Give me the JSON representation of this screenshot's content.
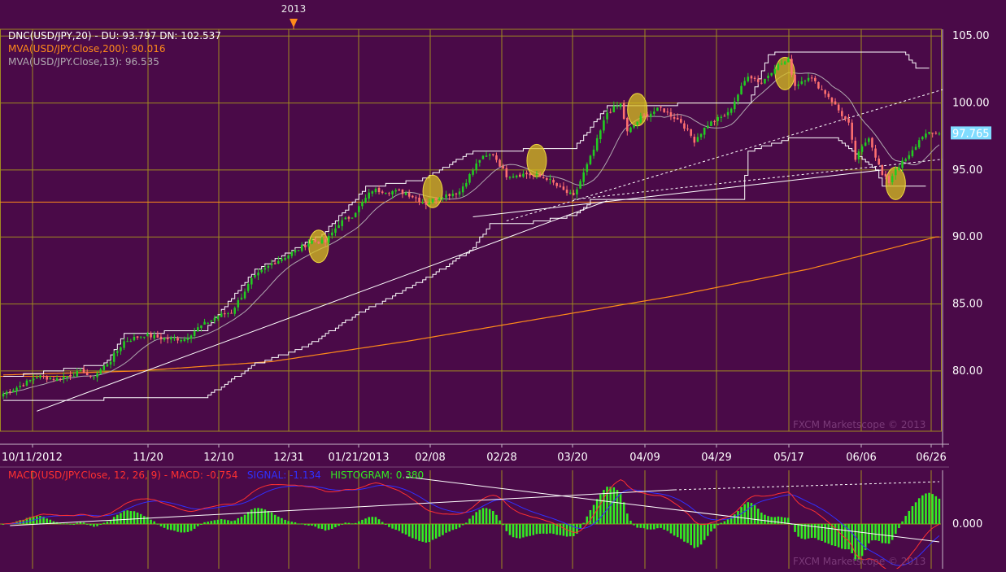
{
  "colors": {
    "background": "#4a0a48",
    "grid": "#a08a20",
    "up_candle": "#22cc22",
    "down_candle": "#ff7070",
    "mva200": "#ff8a1a",
    "mva13": "#b0a8b0",
    "dnc": "#ffffff",
    "macd": "#ff3030",
    "signal": "#3030ff",
    "histogram": "#33ee22",
    "price_tag": "#80dcff",
    "highlight": "#d8c020"
  },
  "year_marker": "2013",
  "legend": {
    "dnc": "DNC(USD/JPY,20)  -   DU: 93.797   DN: 102.537",
    "mva200": "MVA(USD/JPY.Close,200): 90.016",
    "mva13": "MVA(USD/JPY.Close,13): 96.535"
  },
  "macd_legend": {
    "macd": "MACD(USD/JPY.Close, 12, 26, 9)  -   MACD: -0.754",
    "signal": "SIGNAL: -1.134",
    "histogram": "HISTOGRAM: 0.380"
  },
  "price_tag": "97.765",
  "watermark": "FXCM Marketscope © 2013",
  "chart_data": [
    {
      "type": "candlestick",
      "instrument": "USD/JPY",
      "x_labels": [
        "10/11/2012",
        "11/20",
        "12/10",
        "12/31",
        "01/21/2013",
        "02/08",
        "02/28",
        "03/20",
        "04/09",
        "04/29",
        "05/17",
        "06/06",
        "06/26"
      ],
      "y_ticks": [
        "105.00",
        "100.00",
        "95.00",
        "90.00",
        "85.00",
        "80.00"
      ],
      "ylim": [
        75.5,
        105.5
      ],
      "last_price": 97.765,
      "close_anchors": [
        [
          0,
          78.3
        ],
        [
          6,
          79.0
        ],
        [
          10,
          79.6
        ],
        [
          16,
          79.4
        ],
        [
          24,
          80.0
        ],
        [
          26,
          79.4
        ],
        [
          32,
          80.8
        ],
        [
          36,
          82.2
        ],
        [
          42,
          82.7
        ],
        [
          48,
          82.4
        ],
        [
          54,
          82.4
        ],
        [
          58,
          83.2
        ],
        [
          64,
          84.1
        ],
        [
          68,
          84.4
        ],
        [
          74,
          86.8
        ],
        [
          80,
          88.0
        ],
        [
          86,
          88.8
        ],
        [
          92,
          89.7
        ],
        [
          96,
          89.6
        ],
        [
          100,
          91.0
        ],
        [
          104,
          91.6
        ],
        [
          110,
          93.5
        ],
        [
          116,
          93.4
        ],
        [
          120,
          93.3
        ],
        [
          126,
          92.5
        ],
        [
          130,
          93.0
        ],
        [
          136,
          93.4
        ],
        [
          142,
          95.8
        ],
        [
          146,
          96.2
        ],
        [
          150,
          94.6
        ],
        [
          156,
          94.7
        ],
        [
          162,
          94.4
        ],
        [
          166,
          93.6
        ],
        [
          170,
          93.0
        ],
        [
          176,
          96.5
        ],
        [
          180,
          99.3
        ],
        [
          184,
          99.9
        ],
        [
          186,
          97.8
        ],
        [
          190,
          98.9
        ],
        [
          196,
          99.6
        ],
        [
          202,
          98.6
        ],
        [
          206,
          97.2
        ],
        [
          210,
          98.4
        ],
        [
          216,
          99.2
        ],
        [
          222,
          102.1
        ],
        [
          226,
          101.5
        ],
        [
          230,
          102.7
        ],
        [
          234,
          103.2
        ],
        [
          236,
          101.3
        ],
        [
          240,
          102.0
        ],
        [
          246,
          100.5
        ],
        [
          252,
          98.4
        ],
        [
          254,
          95.8
        ],
        [
          258,
          97.5
        ],
        [
          262,
          94.6
        ],
        [
          264,
          94.1
        ],
        [
          266,
          95.1
        ],
        [
          270,
          96.0
        ],
        [
          274,
          97.6
        ],
        [
          278,
          97.77
        ]
      ],
      "mva200_anchors": [
        [
          0,
          79.7
        ],
        [
          40,
          80.0
        ],
        [
          80,
          80.7
        ],
        [
          120,
          82.2
        ],
        [
          160,
          83.9
        ],
        [
          200,
          85.6
        ],
        [
          240,
          87.6
        ],
        [
          278,
          90.0
        ]
      ],
      "dnc_upper_anchors": [
        [
          0,
          79.5
        ],
        [
          30,
          80.5
        ],
        [
          36,
          82.8
        ],
        [
          60,
          83.0
        ],
        [
          75,
          87.5
        ],
        [
          95,
          90.2
        ],
        [
          108,
          93.7
        ],
        [
          125,
          94.3
        ],
        [
          140,
          96.4
        ],
        [
          170,
          96.6
        ],
        [
          180,
          99.8
        ],
        [
          222,
          100.0
        ],
        [
          228,
          103.5
        ],
        [
          230,
          103.8
        ],
        [
          268,
          103.8
        ],
        [
          272,
          102.6
        ],
        [
          276,
          102.6
        ]
      ],
      "dnc_lower_anchors": [
        [
          0,
          77.8
        ],
        [
          60,
          78.0
        ],
        [
          75,
          80.5
        ],
        [
          90,
          81.8
        ],
        [
          105,
          84.2
        ],
        [
          120,
          86.1
        ],
        [
          130,
          87.5
        ],
        [
          140,
          89.2
        ],
        [
          145,
          91.0
        ],
        [
          155,
          91.0
        ],
        [
          170,
          91.6
        ],
        [
          175,
          92.7
        ],
        [
          200,
          92.7
        ],
        [
          220,
          92.7
        ],
        [
          222,
          96.4
        ],
        [
          235,
          97.4
        ],
        [
          248,
          97.4
        ],
        [
          260,
          95.0
        ],
        [
          262,
          93.8
        ],
        [
          275,
          93.8
        ]
      ],
      "trend_lines": [
        {
          "from": [
            10,
            77.0
          ],
          "to": [
            180,
            92.7
          ],
          "style": "solid"
        },
        {
          "from": [
            150,
            91.2
          ],
          "to": [
            280,
            101.0
          ],
          "style": "dashed"
        },
        {
          "from": [
            170,
            92.8
          ],
          "to": [
            280,
            95.8
          ],
          "style": "dashed"
        },
        {
          "from": [
            140,
            91.5
          ],
          "to": [
            262,
            95.0
          ],
          "style": "solid"
        }
      ],
      "support_level": 92.6,
      "resistance_level": 79.6,
      "highlights": [
        [
          94,
          89.3
        ],
        [
          128,
          93.4
        ],
        [
          159,
          95.7
        ],
        [
          189,
          99.5
        ],
        [
          233,
          102.2
        ],
        [
          266,
          94.0
        ]
      ]
    },
    {
      "type": "macd",
      "params": [
        12,
        26,
        9
      ],
      "y_ticks": [
        "0.000"
      ],
      "macd": -0.754,
      "signal": -1.134,
      "histogram": 0.38
    }
  ]
}
